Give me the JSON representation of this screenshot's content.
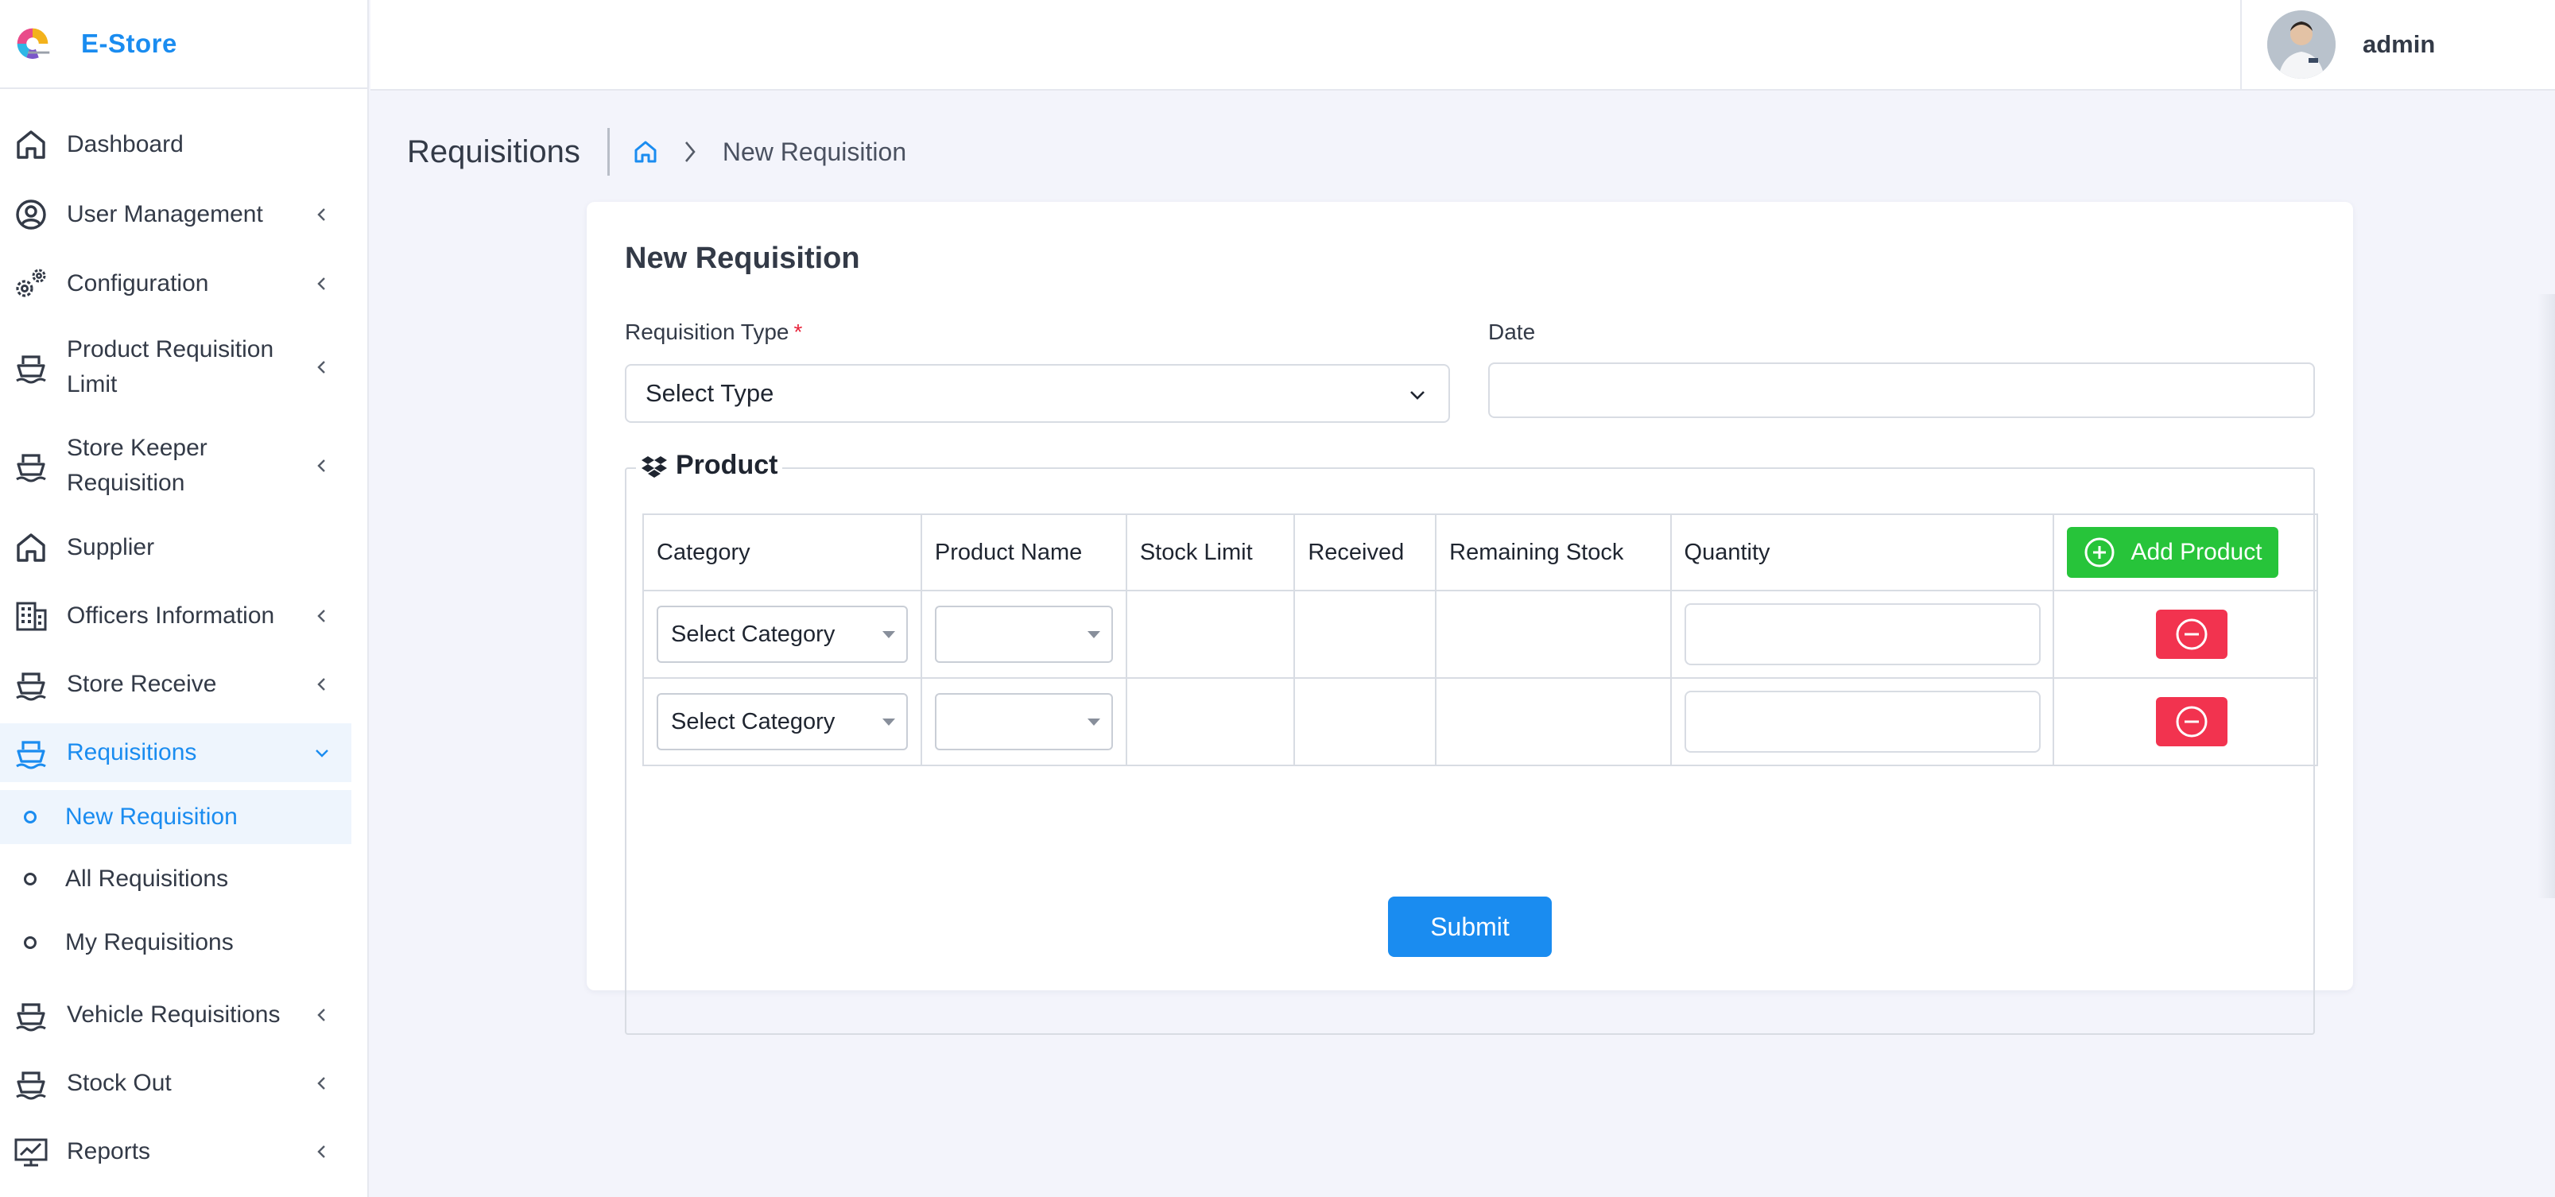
{
  "brand": {
    "name": "E-Store"
  },
  "user": {
    "name": "admin"
  },
  "sidebar": {
    "items": [
      {
        "label": "Dashboard",
        "icon": "home-icon",
        "has_arrow": false
      },
      {
        "label": "User Management",
        "icon": "user-circle-icon",
        "has_arrow": true
      },
      {
        "label": "Configuration",
        "icon": "gears-icon",
        "has_arrow": true
      },
      {
        "label": "Product Requisition Limit",
        "icon": "ship-icon",
        "has_arrow": true
      },
      {
        "label": "Store Keeper Requisition",
        "icon": "ship-icon",
        "has_arrow": true
      },
      {
        "label": "Supplier",
        "icon": "home-icon",
        "has_arrow": false
      },
      {
        "label": "Officers Information",
        "icon": "building-icon",
        "has_arrow": true
      },
      {
        "label": "Store Receive",
        "icon": "ship-icon",
        "has_arrow": true
      },
      {
        "label": "Requisitions",
        "icon": "ship-icon",
        "has_arrow": true,
        "expanded": true
      },
      {
        "label": "Vehicle Requisitions",
        "icon": "ship-icon",
        "has_arrow": true
      },
      {
        "label": "Stock Out",
        "icon": "ship-icon",
        "has_arrow": true
      },
      {
        "label": "Reports",
        "icon": "monitor-chart-icon",
        "has_arrow": true
      }
    ],
    "requisitions_sub": [
      {
        "label": "New Requisition",
        "active": true
      },
      {
        "label": "All Requisitions",
        "active": false
      },
      {
        "label": "My Requisitions",
        "active": false
      }
    ]
  },
  "page": {
    "title": "Requisitions",
    "breadcrumb_current": "New Requisition"
  },
  "form": {
    "title": "New Requisition",
    "requisition_type_label": "Requisition Type",
    "required_mark": "*",
    "requisition_type_value": "Select Type",
    "date_label": "Date",
    "date_value": "",
    "product_legend": "Product",
    "columns": [
      "Category",
      "Product Name",
      "Stock Limit",
      "Received",
      "Remaining Stock",
      "Quantity"
    ],
    "add_product_label": "Add Product",
    "rows": [
      {
        "category": "Select Category",
        "product_name": "",
        "stock_limit": "",
        "received": "",
        "remaining_stock": "",
        "quantity": ""
      },
      {
        "category": "Select Category",
        "product_name": "",
        "stock_limit": "",
        "received": "",
        "remaining_stock": "",
        "quantity": ""
      }
    ],
    "submit_label": "Submit"
  },
  "colors": {
    "accent": "#1a8cf0",
    "add_button": "#27c43a",
    "remove_button": "#f2334f",
    "required": "#e8253c"
  }
}
